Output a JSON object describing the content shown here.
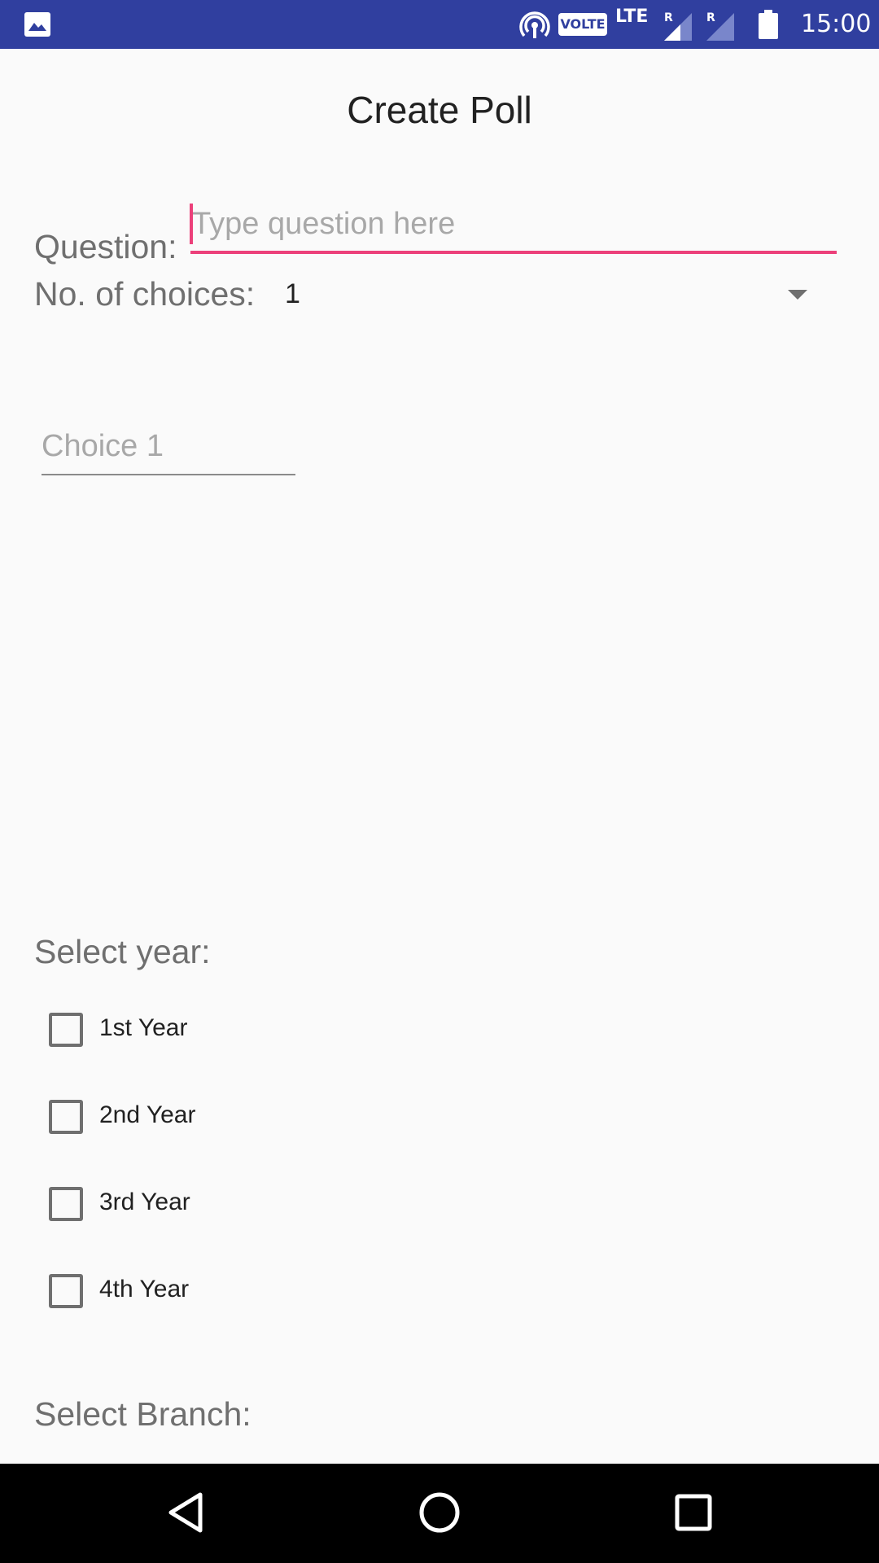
{
  "status_bar": {
    "network_badge": "VOLTE",
    "network_type": "LTE",
    "roaming_1": "R",
    "roaming_2": "R",
    "time": "15:00",
    "icons": [
      "gallery-icon",
      "hotspot-icon",
      "signal-icon",
      "signal-icon",
      "battery-icon"
    ],
    "background_color": "#303f9f"
  },
  "title": "Create Poll",
  "question": {
    "label": "Question:",
    "placeholder": "Type question here",
    "value": "",
    "accent_color": "#ec407a"
  },
  "choices": {
    "label": "No. of choices:",
    "selected": "1"
  },
  "choice_inputs": [
    {
      "placeholder": "Choice 1",
      "value": ""
    }
  ],
  "year": {
    "label": "Select year:",
    "options": [
      {
        "label": "1st Year",
        "checked": false
      },
      {
        "label": "2nd Year",
        "checked": false
      },
      {
        "label": "3rd Year",
        "checked": false
      },
      {
        "label": "4th Year",
        "checked": false
      }
    ]
  },
  "branch": {
    "label": "Select Branch:"
  },
  "nav_bar": {
    "icons": [
      "back-icon",
      "home-icon",
      "recents-icon"
    ]
  }
}
